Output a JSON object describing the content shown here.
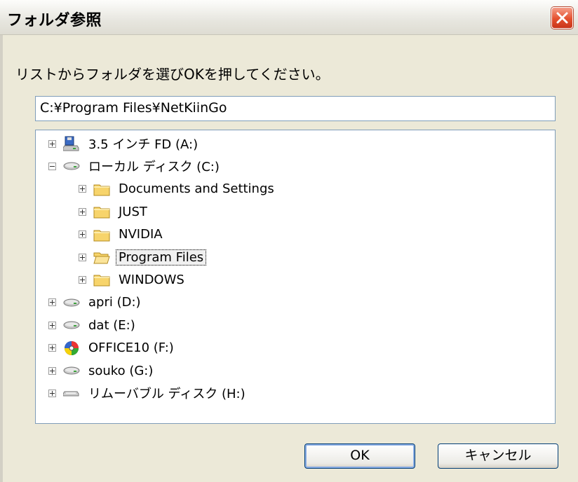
{
  "window": {
    "title": "フォルダ参照"
  },
  "prompt": "リストからフォルダを選びOKを押してください。",
  "path_value": "C:¥Program Files¥NetKiinGo",
  "tree": [
    {
      "label": "3.5 インチ FD (A:)",
      "icon": "floppy-drive-icon",
      "expander": "plus",
      "level": 0
    },
    {
      "label": "ローカル ディスク (C:)",
      "icon": "hard-disk-icon",
      "expander": "minus",
      "level": 0
    },
    {
      "label": "Documents and Settings",
      "icon": "folder-icon",
      "expander": "plus",
      "level": 1
    },
    {
      "label": "JUST",
      "icon": "folder-icon",
      "expander": "plus",
      "level": 1
    },
    {
      "label": "NVIDIA",
      "icon": "folder-icon",
      "expander": "plus",
      "level": 1
    },
    {
      "label": "Program Files",
      "icon": "open-folder-icon",
      "expander": "plus",
      "level": 1,
      "selected": true
    },
    {
      "label": "WINDOWS",
      "icon": "folder-icon",
      "expander": "plus",
      "level": 1
    },
    {
      "label": "apri (D:)",
      "icon": "hard-disk-icon",
      "expander": "plus",
      "level": 0
    },
    {
      "label": "dat (E:)",
      "icon": "hard-disk-icon",
      "expander": "plus",
      "level": 0
    },
    {
      "label": "OFFICE10 (F:)",
      "icon": "cd-drive-icon",
      "expander": "plus",
      "level": 0
    },
    {
      "label": "souko (G:)",
      "icon": "hard-disk-icon",
      "expander": "plus",
      "level": 0
    },
    {
      "label": "リムーバブル ディスク (H:)",
      "icon": "removable-disk-icon",
      "expander": "plus",
      "level": 0
    }
  ],
  "buttons": {
    "ok": "OK",
    "cancel": "キャンセル"
  }
}
